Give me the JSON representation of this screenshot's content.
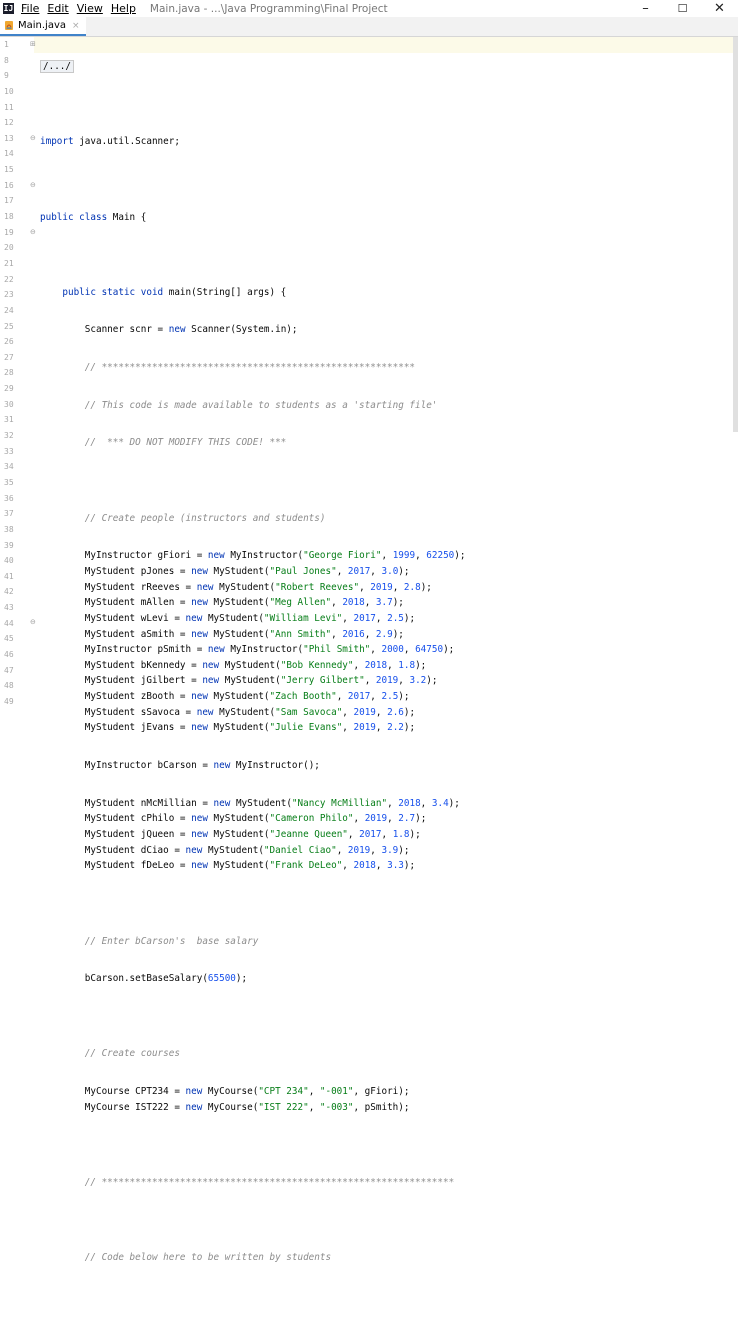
{
  "titlebar": {
    "app_icon": "IJ",
    "menus": [
      "File",
      "Edit",
      "View",
      "Help"
    ],
    "title": "Main.java - ...\\Java Programming\\Final Project",
    "minimize": "–",
    "maximize": "☐",
    "close": "✕"
  },
  "tab": {
    "label": "Main.java",
    "close": "×"
  },
  "line_numbers": [
    "1",
    "8",
    "9",
    "10",
    "11",
    "12",
    "13",
    "14",
    "15",
    "16",
    "17",
    "18",
    "19",
    "20",
    "21",
    "22",
    "23",
    "24",
    "25",
    "26",
    "27",
    "28",
    "29",
    "30",
    "31",
    "32",
    "33",
    "34",
    "35",
    "36",
    "37",
    "38",
    "39",
    "40",
    "41",
    "42",
    "43",
    "44",
    "45",
    "46",
    "47",
    "48",
    "49"
  ],
  "code": {
    "l1": "/.../",
    "l9_kw": "import",
    "l9_rest": " java.util.Scanner;",
    "l11_kw": "public class",
    "l11_rest": " Main {",
    "l13_kw": "public static void",
    "l13_rest": " main(String[] args) {",
    "l14_a": "Scanner scnr = ",
    "l14_kw": "new",
    "l14_b": " Scanner(System.in);",
    "l15": "// ********************************************************",
    "l16": "// This code is made available to students as a 'starting file'",
    "l17": "//  *** DO NOT MODIFY THIS CODE! ***",
    "l19": "// Create people (instructors and students)",
    "students": [
      {
        "a": "MyInstructor gFiori = ",
        "s": "\"George Fiori\"",
        "n1": "1999",
        "n2": "62250",
        "cls": "MyInstructor"
      },
      {
        "a": "MyStudent pJones = ",
        "s": "\"Paul Jones\"",
        "n1": "2017",
        "n2": "3.0",
        "cls": "MyStudent"
      },
      {
        "a": "MyStudent rReeves = ",
        "s": "\"Robert Reeves\"",
        "n1": "2019",
        "n2": "2.8",
        "cls": "MyStudent"
      },
      {
        "a": "MyStudent mAllen = ",
        "s": "\"Meg Allen\"",
        "n1": "2018",
        "n2": "3.7",
        "cls": "MyStudent"
      },
      {
        "a": "MyStudent wLevi = ",
        "s": "\"William Levi\"",
        "n1": "2017",
        "n2": "2.5",
        "cls": "MyStudent"
      },
      {
        "a": "MyStudent aSmith = ",
        "s": "\"Ann Smith\"",
        "n1": "2016",
        "n2": "2.9",
        "cls": "MyStudent"
      },
      {
        "a": "MyInstructor pSmith = ",
        "s": "\"Phil Smith\"",
        "n1": "2000",
        "n2": "64750",
        "cls": "MyInstructor"
      },
      {
        "a": "MyStudent bKennedy = ",
        "s": "\"Bob Kennedy\"",
        "n1": "2018",
        "n2": "1.8",
        "cls": "MyStudent"
      },
      {
        "a": "MyStudent jGilbert = ",
        "s": "\"Jerry Gilbert\"",
        "n1": "2019",
        "n2": "3.2",
        "cls": "MyStudent"
      },
      {
        "a": "MyStudent zBooth = ",
        "s": "\"Zach Booth\"",
        "n1": "2017",
        "n2": "2.5",
        "cls": "MyStudent"
      },
      {
        "a": "MyStudent sSavoca = ",
        "s": "\"Sam Savoca\"",
        "n1": "2019",
        "n2": "2.6",
        "cls": "MyStudent"
      },
      {
        "a": "MyStudent jEvans = ",
        "s": "\"Julie Evans\"",
        "n1": "2019",
        "n2": "2.2",
        "cls": "MyStudent"
      }
    ],
    "l32_a": "MyInstructor bCarson = ",
    "l32_b": " MyInstructor();",
    "students2": [
      {
        "a": "MyStudent nMcMillian = ",
        "s": "\"Nancy McMillian\"",
        "n1": "2018",
        "n2": "3.4",
        "cls": "MyStudent"
      },
      {
        "a": "MyStudent cPhilo = ",
        "s": "\"Cameron Philo\"",
        "n1": "2019",
        "n2": "2.7",
        "cls": "MyStudent"
      },
      {
        "a": "MyStudent jQueen = ",
        "s": "\"Jeanne Queen\"",
        "n1": "2017",
        "n2": "1.8",
        "cls": "MyStudent"
      },
      {
        "a": "MyStudent dCiao = ",
        "s": "\"Daniel Ciao\"",
        "n1": "2019",
        "n2": "3.9",
        "cls": "MyStudent"
      },
      {
        "a": "MyStudent fDeLeo = ",
        "s": "\"Frank DeLeo\"",
        "n1": "2018",
        "n2": "3.3",
        "cls": "MyStudent"
      }
    ],
    "new_kw": "new",
    "l39": "// Enter bCarson's  base salary",
    "l40_a": "bCarson.setBaseSalary(",
    "l40_n": "65500",
    "l40_b": ");",
    "l42": "// Create courses",
    "courses": [
      {
        "a": "MyCourse CPT234 = ",
        "b": " MyCourse(",
        "s1": "\"CPT 234\"",
        "s2": "\"-001\"",
        "c": ", gFiori);"
      },
      {
        "a": "MyCourse IST222 = ",
        "b": " MyCourse(",
        "s1": "\"IST 222\"",
        "s2": "\"-003\"",
        "c": ", pSmith);"
      }
    ],
    "l46": "// ***************************************************************",
    "l48": "// Code below here to be written by students"
  }
}
